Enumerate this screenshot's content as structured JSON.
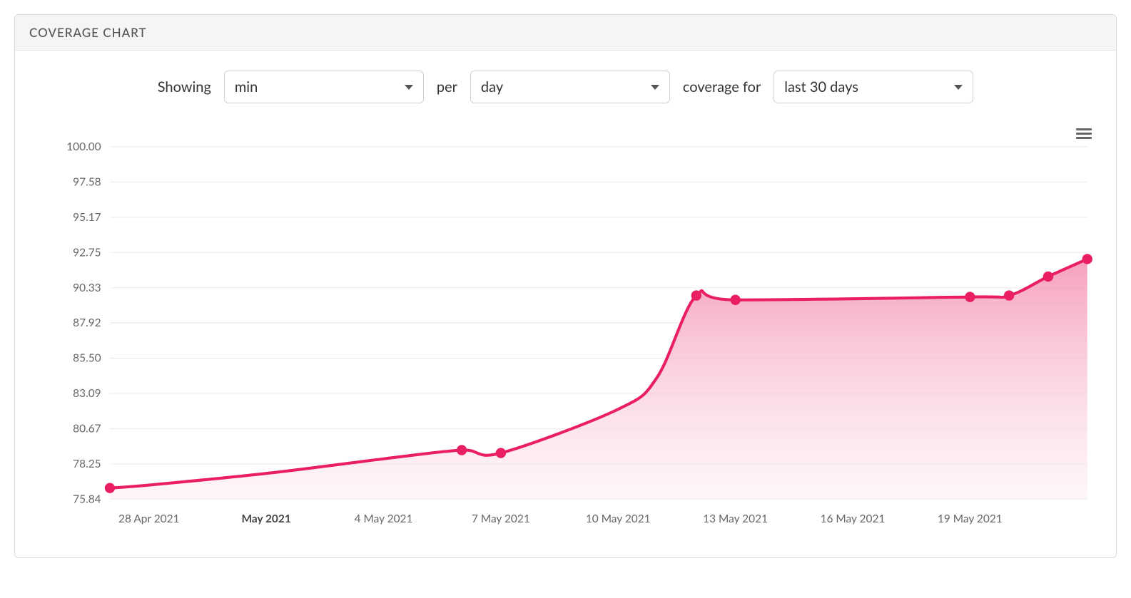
{
  "header": {
    "title": "COVERAGE CHART"
  },
  "controls": {
    "showing_label": "Showing",
    "agg_selected": "min",
    "per_label": "per",
    "interval_selected": "day",
    "coverage_for_label": "coverage for",
    "range_selected": "last 30 days"
  },
  "chart_data": {
    "type": "area",
    "x": [
      "27 Apr 2021",
      "28 Apr 2021",
      "1 May 2021",
      "4 May 2021",
      "6 May 2021",
      "7 May 2021",
      "10 May 2021",
      "11 May 2021",
      "12 May 2021",
      "13 May 2021",
      "19 May 2021",
      "20 May 2021",
      "21 May 2021",
      "22 May 2021"
    ],
    "values": [
      76.6,
      76.8,
      77.6,
      78.6,
      79.2,
      79.0,
      82.0,
      84.2,
      89.8,
      89.5,
      89.7,
      89.8,
      91.1,
      92.3
    ],
    "markers_x": [
      "27 Apr 2021",
      "6 May 2021",
      "7 May 2021",
      "12 May 2021",
      "13 May 2021",
      "19 May 2021",
      "20 May 2021",
      "21 May 2021",
      "22 May 2021"
    ],
    "markers_y": [
      76.6,
      79.2,
      79.0,
      89.8,
      89.5,
      89.7,
      89.8,
      91.1,
      92.3
    ],
    "x_ticks": [
      {
        "label": "28 Apr 2021",
        "bold": false
      },
      {
        "label": "May 2021",
        "bold": true
      },
      {
        "label": "4 May 2021",
        "bold": false
      },
      {
        "label": "7 May 2021",
        "bold": false
      },
      {
        "label": "10 May 2021",
        "bold": false
      },
      {
        "label": "13 May 2021",
        "bold": false
      },
      {
        "label": "16 May 2021",
        "bold": false
      },
      {
        "label": "19 May 2021",
        "bold": false
      }
    ],
    "y_ticks": [
      "75.84",
      "78.25",
      "80.67",
      "83.09",
      "85.50",
      "87.92",
      "90.33",
      "92.75",
      "95.17",
      "97.58",
      "100.00"
    ],
    "ylim": [
      75.84,
      100.0
    ],
    "xlabel": "",
    "ylabel": "",
    "title": "",
    "color": "#e91e63"
  }
}
